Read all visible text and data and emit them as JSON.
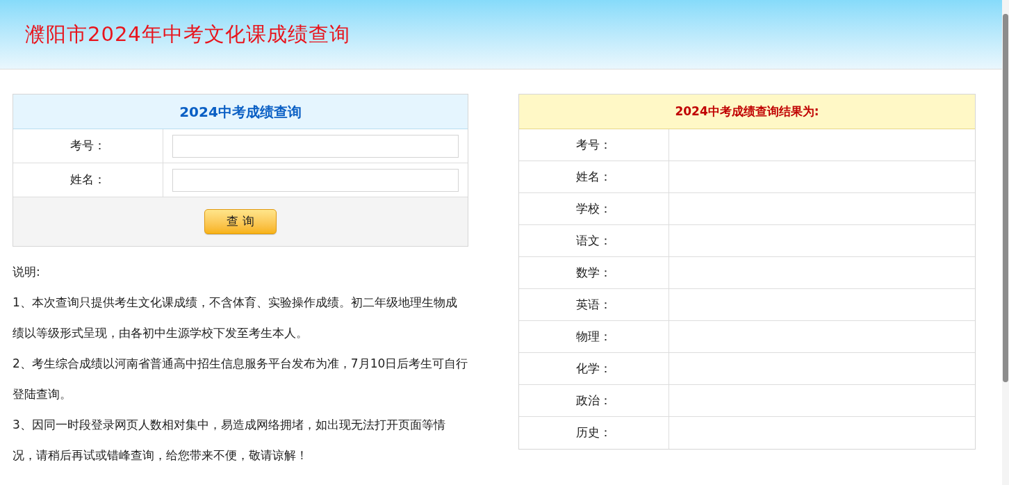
{
  "header": {
    "title": "濮阳市2024年中考文化课成绩查询"
  },
  "query_form": {
    "title": "2024中考成绩查询",
    "fields": [
      {
        "label": "考号："
      },
      {
        "label": "姓名："
      }
    ],
    "submit_button": "查 询"
  },
  "notes": {
    "heading": "说明:",
    "items": [
      "1、本次查询只提供考生文化课成绩，不含体育、实验操作成绩。初二年级地理生物成绩以等级形式呈现，由各初中生源学校下发至考生本人。",
      "2、考生综合成绩以河南省普通高中招生信息服务平台发布为准，7月10日后考生可自行登陆查询。",
      "3、因同一时段登录网页人数相对集中，易造成网络拥堵，如出现无法打开页面等情况，请稍后再试或错峰查询，给您带来不便，敬请谅解！"
    ]
  },
  "result": {
    "title": "2024中考成绩查询结果为:",
    "rows": [
      {
        "label": "考号："
      },
      {
        "label": "姓名："
      },
      {
        "label": "学校："
      },
      {
        "label": "语文："
      },
      {
        "label": "数学："
      },
      {
        "label": "英语："
      },
      {
        "label": "物理："
      },
      {
        "label": "化学："
      },
      {
        "label": "政治："
      },
      {
        "label": "历史："
      }
    ]
  }
}
